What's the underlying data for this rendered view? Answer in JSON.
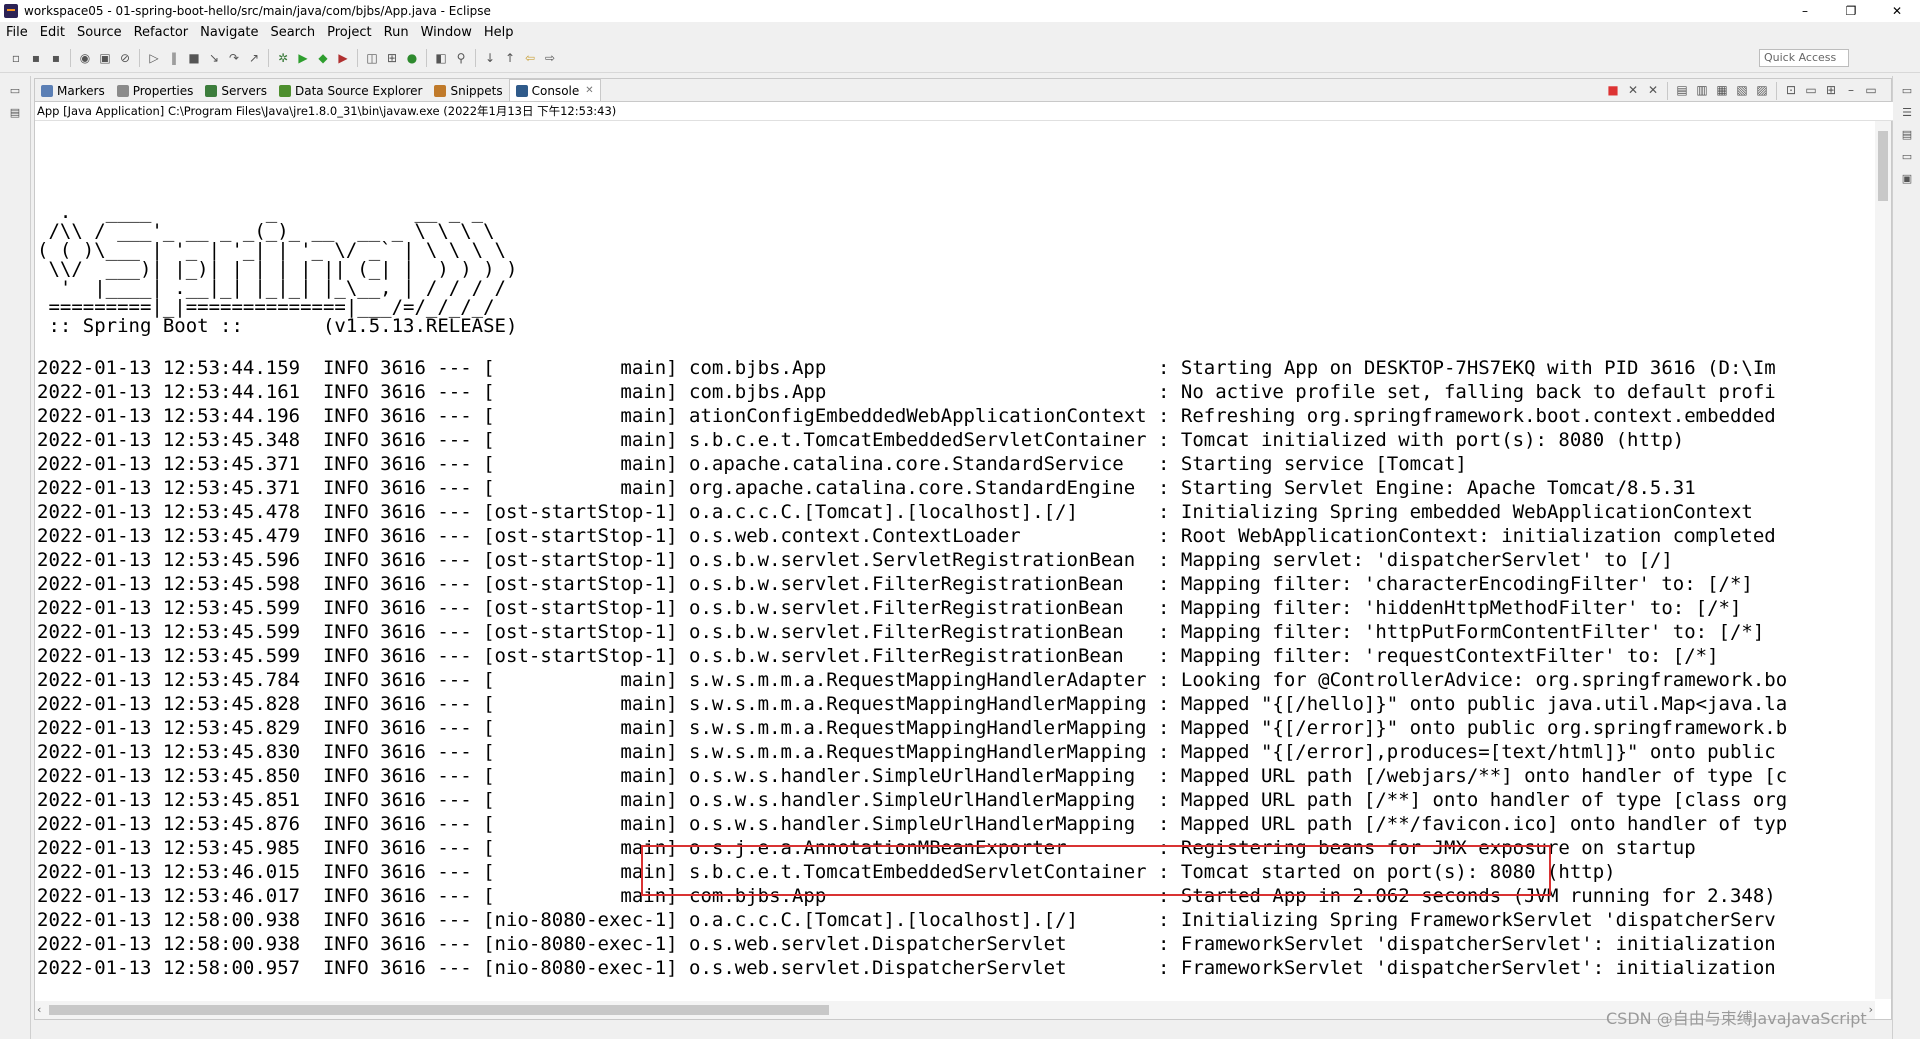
{
  "window": {
    "title": "workspace05 - 01-spring-boot-hello/src/main/java/com/bjbs/App.java - Eclipse",
    "minimize": "–",
    "restore": "❐",
    "close": "✕"
  },
  "menu": [
    "File",
    "Edit",
    "Source",
    "Refactor",
    "Navigate",
    "Search",
    "Project",
    "Run",
    "Window",
    "Help"
  ],
  "quick_access": {
    "placeholder": "Quick Access"
  },
  "tabs": [
    {
      "label": "Markers",
      "color": "#5b7fb5"
    },
    {
      "label": "Properties",
      "color": "#8a8a8a"
    },
    {
      "label": "Servers",
      "color": "#3c7d3c"
    },
    {
      "label": "Data Source Explorer",
      "color": "#4e8f2e"
    },
    {
      "label": "Snippets",
      "color": "#c07a2a"
    },
    {
      "label": "Console",
      "color": "#2f5a8a",
      "active": true,
      "close": "✕"
    }
  ],
  "process": "App [Java Application] C:\\Program Files\\Java\\jre1.8.0_31\\bin\\javaw.exe (2022年1月13日 下午12:53:43)",
  "banner": "  .   ____          _            __ _ _\n /\\\\ / ___'_ __ _ _(_)_ __  __ _ \\ \\ \\ \\\n( ( )\\___ | '_ | '_| | '_ \\/ _` | \\ \\ \\ \\\n \\\\/  ___)| |_)| | | | | || (_| |  ) ) ) )\n  '  |____| .__|_| |_|_| |_\\__, | / / / /\n =========|_|==============|___/=/_/_/_/\n :: Spring Boot ::       (v1.5.13.RELEASE)",
  "log": [
    "2022-01-13 12:53:44.159  INFO 3616 --- [           main] com.bjbs.App                             : Starting App on DESKTOP-7HS7EKQ with PID 3616 (D:\\Im",
    "2022-01-13 12:53:44.161  INFO 3616 --- [           main] com.bjbs.App                             : No active profile set, falling back to default profi",
    "2022-01-13 12:53:44.196  INFO 3616 --- [           main] ationConfigEmbeddedWebApplicationContext : Refreshing org.springframework.boot.context.embedded",
    "2022-01-13 12:53:45.348  INFO 3616 --- [           main] s.b.c.e.t.TomcatEmbeddedServletContainer : Tomcat initialized with port(s): 8080 (http)",
    "2022-01-13 12:53:45.371  INFO 3616 --- [           main] o.apache.catalina.core.StandardService   : Starting service [Tomcat]",
    "2022-01-13 12:53:45.371  INFO 3616 --- [           main] org.apache.catalina.core.StandardEngine  : Starting Servlet Engine: Apache Tomcat/8.5.31",
    "2022-01-13 12:53:45.478  INFO 3616 --- [ost-startStop-1] o.a.c.c.C.[Tomcat].[localhost].[/]       : Initializing Spring embedded WebApplicationContext",
    "2022-01-13 12:53:45.479  INFO 3616 --- [ost-startStop-1] o.s.web.context.ContextLoader            : Root WebApplicationContext: initialization completed",
    "2022-01-13 12:53:45.596  INFO 3616 --- [ost-startStop-1] o.s.b.w.servlet.ServletRegistrationBean  : Mapping servlet: 'dispatcherServlet' to [/]",
    "2022-01-13 12:53:45.598  INFO 3616 --- [ost-startStop-1] o.s.b.w.servlet.FilterRegistrationBean   : Mapping filter: 'characterEncodingFilter' to: [/*]",
    "2022-01-13 12:53:45.599  INFO 3616 --- [ost-startStop-1] o.s.b.w.servlet.FilterRegistrationBean   : Mapping filter: 'hiddenHttpMethodFilter' to: [/*]",
    "2022-01-13 12:53:45.599  INFO 3616 --- [ost-startStop-1] o.s.b.w.servlet.FilterRegistrationBean   : Mapping filter: 'httpPutFormContentFilter' to: [/*]",
    "2022-01-13 12:53:45.599  INFO 3616 --- [ost-startStop-1] o.s.b.w.servlet.FilterRegistrationBean   : Mapping filter: 'requestContextFilter' to: [/*]",
    "2022-01-13 12:53:45.784  INFO 3616 --- [           main] s.w.s.m.m.a.RequestMappingHandlerAdapter : Looking for @ControllerAdvice: org.springframework.bo",
    "2022-01-13 12:53:45.828  INFO 3616 --- [           main] s.w.s.m.m.a.RequestMappingHandlerMapping : Mapped \"{[/hello]}\" onto public java.util.Map<java.la",
    "2022-01-13 12:53:45.829  INFO 3616 --- [           main] s.w.s.m.m.a.RequestMappingHandlerMapping : Mapped \"{[/error]}\" onto public org.springframework.b",
    "2022-01-13 12:53:45.830  INFO 3616 --- [           main] s.w.s.m.m.a.RequestMappingHandlerMapping : Mapped \"{[/error],produces=[text/html]}\" onto public",
    "2022-01-13 12:53:45.850  INFO 3616 --- [           main] o.s.w.s.handler.SimpleUrlHandlerMapping  : Mapped URL path [/webjars/**] onto handler of type [c",
    "2022-01-13 12:53:45.851  INFO 3616 --- [           main] o.s.w.s.handler.SimpleUrlHandlerMapping  : Mapped URL path [/**] onto handler of type [class org",
    "2022-01-13 12:53:45.876  INFO 3616 --- [           main] o.s.w.s.handler.SimpleUrlHandlerMapping  : Mapped URL path [/**/favicon.ico] onto handler of typ",
    "2022-01-13 12:53:45.985  INFO 3616 --- [           main] o.s.j.e.a.AnnotationMBeanExporter        : Registering beans for JMX exposure on startup",
    "2022-01-13 12:53:46.015  INFO 3616 --- [           main] s.b.c.e.t.TomcatEmbeddedServletContainer : Tomcat started on port(s): 8080 (http)",
    "2022-01-13 12:53:46.017  INFO 3616 --- [           main] com.bjbs.App                             : Started App in 2.062 seconds (JVM running for 2.348)",
    "2022-01-13 12:58:00.938  INFO 3616 --- [nio-8080-exec-1] o.a.c.c.C.[Tomcat].[localhost].[/]       : Initializing Spring FrameworkServlet 'dispatcherServ",
    "2022-01-13 12:58:00.938  INFO 3616 --- [nio-8080-exec-1] o.s.web.servlet.DispatcherServlet        : FrameworkServlet 'dispatcherServlet': initialization",
    "2022-01-13 12:58:00.957  INFO 3616 --- [nio-8080-exec-1] o.s.web.servlet.DispatcherServlet        : FrameworkServlet 'dispatcherServlet': initialization"
  ],
  "highlight_color": "#d93232",
  "watermark": "CSDN @自由与束缚JavaJavaScript"
}
